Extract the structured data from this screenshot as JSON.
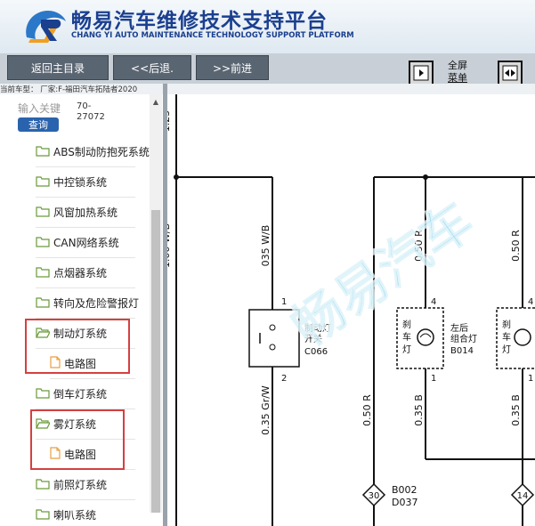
{
  "header": {
    "title_cn": "畅易汽车维修技术支持平台",
    "title_en": "CHANG YI AUTO MAINTENANCE TECHNOLOGY SUPPORT PLATFORM"
  },
  "toolbar": {
    "back_label": "返回主目录",
    "prev_label": "<<后退.",
    "next_label": ">>前进",
    "fullscreen_label": "全屏",
    "menu_label": "菜单"
  },
  "status_line": "当前车型：  厂家:F-福田汽车拓陆者2020",
  "sidebar": {
    "search_placeholder": "输入关键",
    "search_button": "查询",
    "result_code": "70-27072",
    "items": [
      {
        "label": "ABS制动防抱死系统",
        "type": "folder"
      },
      {
        "label": "中控锁系统",
        "type": "folder"
      },
      {
        "label": "风窗加热系统",
        "type": "folder"
      },
      {
        "label": "CAN网络系统",
        "type": "folder"
      },
      {
        "label": "点烟器系统",
        "type": "folder"
      },
      {
        "label": "转向及危险警报灯",
        "type": "folder"
      },
      {
        "label": "制动灯系统",
        "type": "folder-open"
      },
      {
        "label": "电路图",
        "type": "file"
      },
      {
        "label": "倒车灯系统",
        "type": "folder"
      },
      {
        "label": "雾灯系统",
        "type": "folder-open"
      },
      {
        "label": "电路图",
        "type": "file"
      },
      {
        "label": "前照灯系统",
        "type": "folder"
      },
      {
        "label": "喇叭系统",
        "type": "folder"
      }
    ]
  },
  "diagram": {
    "wire_labels": [
      "035 W/B",
      "0.50 R",
      "0.50 R",
      "0.35 Gr/W",
      "0.50 R",
      "0.35 B",
      "0.35 B"
    ],
    "left_edge_labels": [
      "1.25",
      "1.00 W/B"
    ],
    "pins": [
      "1",
      "2",
      "4",
      "1",
      "4",
      "1"
    ],
    "switch_label": [
      "制动灯",
      "开关",
      "C066"
    ],
    "brake_lamp_label": [
      "刹",
      "车",
      "灯"
    ],
    "brake_lamp_label_2": [
      "刹",
      "车",
      "灯"
    ],
    "combo_lamp_label": [
      "左后",
      "组合灯",
      "B014"
    ],
    "connector_number": "30",
    "connector_codes": [
      "B002",
      "D037"
    ],
    "connector_number_2": "14",
    "watermark": "畅易汽车"
  },
  "colors": {
    "brand_blue": "#1b3f8f",
    "button_dark": "#5a6572",
    "highlight_red": "#d44040",
    "watermark_cyan": "#46bee1"
  }
}
